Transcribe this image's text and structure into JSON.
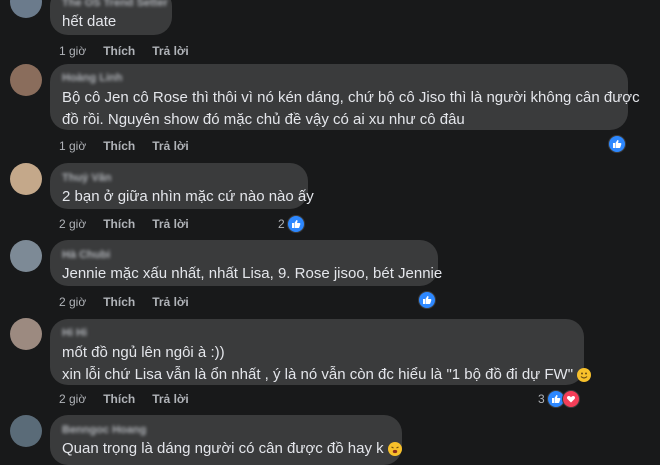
{
  "actions": {
    "like": "Thích",
    "reply": "Trả lời"
  },
  "comments": [
    {
      "author": "The OS Trend Setter",
      "lines": [
        "hết date"
      ],
      "time": "1 giờ",
      "reactions": ""
    },
    {
      "author": "Hoàng Linh",
      "lines": [
        "Bộ cô Jen cô Rose thì thôi vì nó kén dáng, chứ bộ cô Jiso thì là người không cân được",
        "đồ rồi. Nguyên show đó mặc chủ đề vậy có ai xu như cô đâu"
      ],
      "time": "1 giờ",
      "reactions": ""
    },
    {
      "author": "Thuỷ Vân",
      "lines": [
        "2 bạn ở giữa nhìn mặc cứ nào nào ấy"
      ],
      "time": "2 giờ",
      "reactions": "2"
    },
    {
      "author": "Hà Chubi",
      "lines": [
        "Jennie mặc xấu nhất, nhất Lisa, 9. Rose jisoo, bét Jennie"
      ],
      "time": "2 giờ",
      "reactions": ""
    },
    {
      "author": "Hi Hi",
      "lines": [
        "mốt đồ ngủ lên ngôi à :))",
        "xin lỗi chứ Lisa vẫn là ổn nhất , ý là nó vẫn còn đc hiểu là \"1 bộ đồ đi dự FW\""
      ],
      "time": "2 giờ",
      "reactions": "3"
    },
    {
      "author": "Benngoc Hoang",
      "lines": [
        "Quan trọng là dáng người có cân được đồ hay k"
      ],
      "time": "2 giờ",
      "reactions": ""
    }
  ],
  "colors": {
    "like_blue": "#2d88ff",
    "heart_red": "#f33e58",
    "bubble": "#3a3b3c",
    "background": "#18191a"
  }
}
